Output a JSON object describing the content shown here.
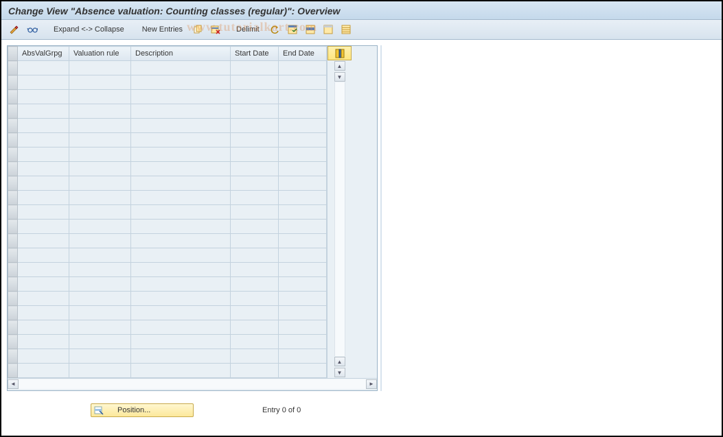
{
  "title": "Change View \"Absence valuation: Counting classes (regular)\": Overview",
  "toolbar": {
    "expand_collapse_label": "Expand <-> Collapse",
    "new_entries_label": "New Entries",
    "delimit_label": "Delimit"
  },
  "watermark_text": "www.tutorialkart.com",
  "table": {
    "columns": [
      {
        "key": "abs",
        "label": "AbsValGrpg"
      },
      {
        "key": "rule",
        "label": "Valuation rule"
      },
      {
        "key": "desc",
        "label": "Description"
      },
      {
        "key": "start",
        "label": "Start Date"
      },
      {
        "key": "end",
        "label": "End Date"
      }
    ],
    "rows": [
      {
        "abs": "",
        "rule": "",
        "desc": "",
        "start": "",
        "end": ""
      },
      {
        "abs": "",
        "rule": "",
        "desc": "",
        "start": "",
        "end": ""
      },
      {
        "abs": "",
        "rule": "",
        "desc": "",
        "start": "",
        "end": ""
      },
      {
        "abs": "",
        "rule": "",
        "desc": "",
        "start": "",
        "end": ""
      },
      {
        "abs": "",
        "rule": "",
        "desc": "",
        "start": "",
        "end": ""
      },
      {
        "abs": "",
        "rule": "",
        "desc": "",
        "start": "",
        "end": ""
      },
      {
        "abs": "",
        "rule": "",
        "desc": "",
        "start": "",
        "end": ""
      },
      {
        "abs": "",
        "rule": "",
        "desc": "",
        "start": "",
        "end": ""
      },
      {
        "abs": "",
        "rule": "",
        "desc": "",
        "start": "",
        "end": ""
      },
      {
        "abs": "",
        "rule": "",
        "desc": "",
        "start": "",
        "end": ""
      },
      {
        "abs": "",
        "rule": "",
        "desc": "",
        "start": "",
        "end": ""
      },
      {
        "abs": "",
        "rule": "",
        "desc": "",
        "start": "",
        "end": ""
      },
      {
        "abs": "",
        "rule": "",
        "desc": "",
        "start": "",
        "end": ""
      },
      {
        "abs": "",
        "rule": "",
        "desc": "",
        "start": "",
        "end": ""
      },
      {
        "abs": "",
        "rule": "",
        "desc": "",
        "start": "",
        "end": ""
      },
      {
        "abs": "",
        "rule": "",
        "desc": "",
        "start": "",
        "end": ""
      },
      {
        "abs": "",
        "rule": "",
        "desc": "",
        "start": "",
        "end": ""
      },
      {
        "abs": "",
        "rule": "",
        "desc": "",
        "start": "",
        "end": ""
      },
      {
        "abs": "",
        "rule": "",
        "desc": "",
        "start": "",
        "end": ""
      },
      {
        "abs": "",
        "rule": "",
        "desc": "",
        "start": "",
        "end": ""
      },
      {
        "abs": "",
        "rule": "",
        "desc": "",
        "start": "",
        "end": ""
      },
      {
        "abs": "",
        "rule": "",
        "desc": "",
        "start": "",
        "end": ""
      }
    ]
  },
  "footer": {
    "position_label": "Position...",
    "entry_text": "Entry 0 of 0"
  },
  "icons": {
    "toggle": "toggle-icon",
    "glasses": "glasses-icon",
    "copy": "copy-icon",
    "copy_all": "copy-all-icon",
    "undo": "undo-icon",
    "select_all": "select-all-icon",
    "select_block": "select-block-icon",
    "deselect_all": "deselect-all-icon",
    "config": "table-settings-icon",
    "position": "position-icon"
  }
}
